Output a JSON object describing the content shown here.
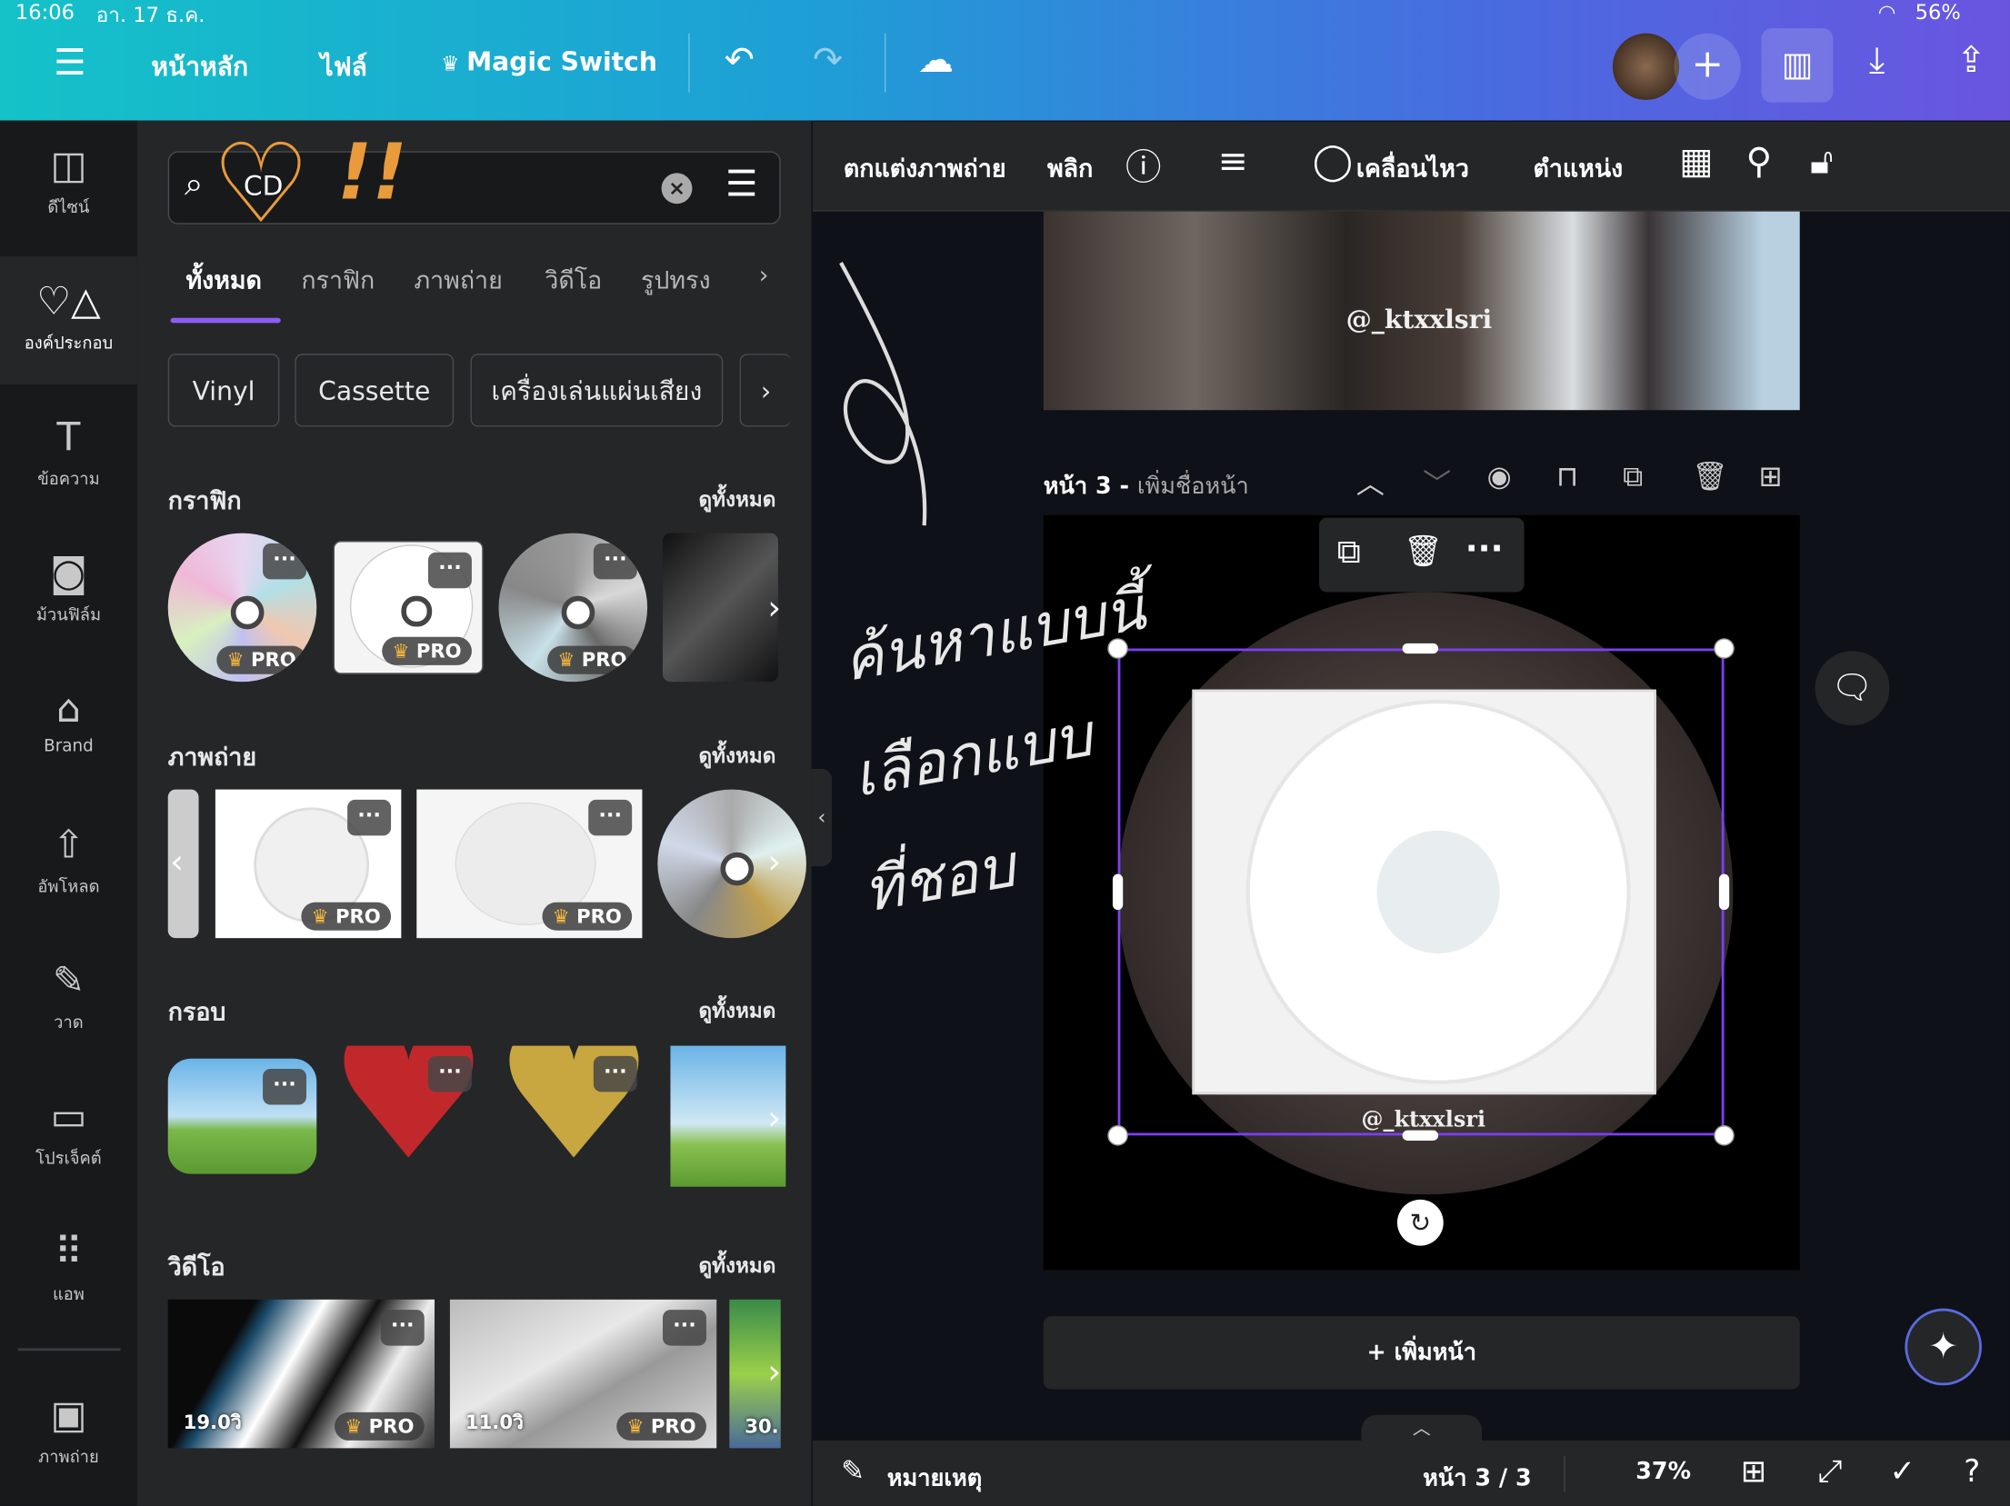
{
  "status": {
    "time": "16:06",
    "date": "อา. 17 ธ.ค.",
    "battery": "56%"
  },
  "topbar": {
    "menu_icon": "hamburger-icon",
    "home": "หน้าหลัก",
    "file": "ไฟล์",
    "magic_switch": "Magic Switch",
    "gradient": [
      "#14c2c8",
      "#6a55e0"
    ]
  },
  "rail": [
    {
      "label": "ดีไซน์",
      "icon": "layout-icon"
    },
    {
      "label": "องค์ประกอบ",
      "icon": "elements-icon"
    },
    {
      "label": "ข้อความ",
      "icon": "text-icon"
    },
    {
      "label": "ม้วนฟิล์ม",
      "icon": "camera-icon"
    },
    {
      "label": "Brand",
      "icon": "brand-icon"
    },
    {
      "label": "อัพโหลด",
      "icon": "upload-icon"
    },
    {
      "label": "วาด",
      "icon": "draw-icon"
    },
    {
      "label": "โปรเจ็คต์",
      "icon": "folder-icon"
    },
    {
      "label": "แอพ",
      "icon": "apps-icon"
    },
    {
      "label": "ภาพถ่าย",
      "icon": "photo-icon"
    }
  ],
  "search": {
    "value": "CD"
  },
  "tabs": [
    "ทั้งหมด",
    "กราฟิก",
    "ภาพถ่าย",
    "วิดีโอ",
    "รูปทรง"
  ],
  "chips": [
    "Vinyl",
    "Cassette",
    "เครื่องเล่นแผ่นเสียง"
  ],
  "sections": {
    "graphics": {
      "title": "กราฟิก",
      "see_all": "ดูทั้งหมด"
    },
    "photos": {
      "title": "ภาพถ่าย",
      "see_all": "ดูทั้งหมด"
    },
    "frames": {
      "title": "กรอบ",
      "see_all": "ดูทั้งหมด"
    },
    "videos": {
      "title": "วิดีโอ",
      "see_all": "ดูทั้งหมด",
      "durations": [
        "19.0วิ",
        "11.0วิ",
        "30."
      ]
    }
  },
  "badge": {
    "pro": "PRO",
    "accent": "#f6b73c"
  },
  "annotation": {
    "lines": [
      "ค้นหาแบบนี้",
      "เลือกแบบ",
      "ที่ชอบ"
    ],
    "mark": "!!"
  },
  "ctx": {
    "edit_photo": "ตกแต่งภาพถ่าย",
    "flip": "พลิก",
    "animate": "เคลื่อนไหว",
    "position": "ตำแหน่ง"
  },
  "canvas": {
    "watermark": "@_ktxxlsri",
    "page_label": "หน้า 3 - ",
    "page_name_placeholder": "เพิ่มชื่อหน้า",
    "add_page": "+ เพิ่มหน้า",
    "selection_color": "#7b3ff2"
  },
  "bottom": {
    "notes": "หมายเหตุ",
    "page": "หน้า 3 / 3",
    "zoom": "37%"
  }
}
